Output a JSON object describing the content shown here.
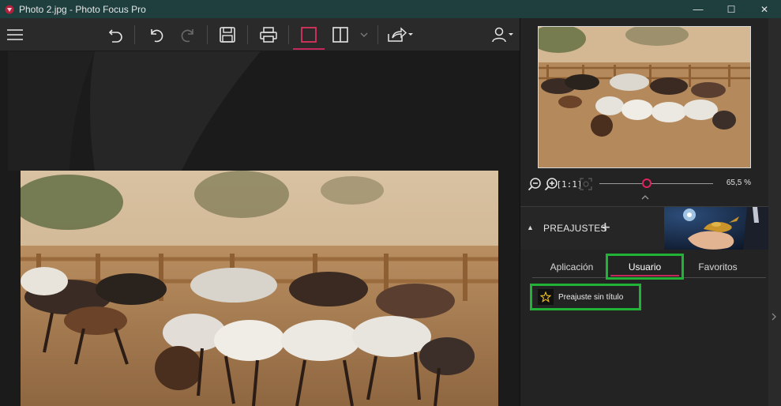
{
  "window": {
    "title": "Photo 2.jpg - Photo Focus Pro",
    "minimize": "—",
    "maximize": "☐",
    "close": "✕"
  },
  "toolbar": {
    "items": [
      "menu-icon",
      "undo-history-icon",
      "undo-icon",
      "redo-icon",
      "save-icon",
      "print-icon",
      "single-view-icon",
      "split-view-icon",
      "split-view-dropdown-icon",
      "share-icon",
      "user-account-icon"
    ],
    "accent": "#c2285a"
  },
  "navigator": {
    "zoom_value": "65,5 %",
    "zoom_fraction": 0.42,
    "buttons": [
      "zoom-out-icon",
      "zoom-in-icon",
      "actual-size-icon",
      "fit-screen-icon"
    ],
    "actual_size_label": "[1:1]"
  },
  "presets": {
    "heading": "PREAJUSTES",
    "add_label": "+",
    "tabs": [
      {
        "label": "Aplicación",
        "active": false
      },
      {
        "label": "Usuario",
        "active": true
      },
      {
        "label": "Favoritos",
        "active": false
      }
    ],
    "items": [
      {
        "label": "Preajuste sin título"
      }
    ],
    "highlight_color": "#21b335"
  }
}
